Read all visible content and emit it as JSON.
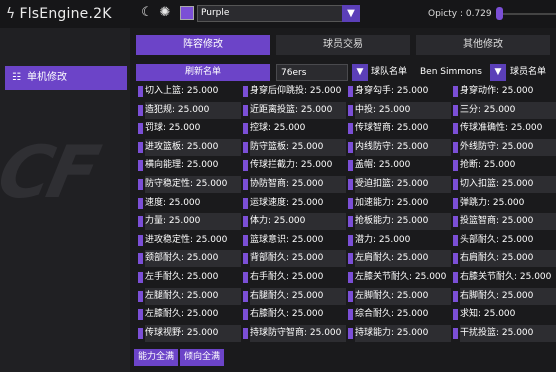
{
  "app": {
    "title": "FlsEngine.2K"
  },
  "topbar": {
    "theme_label": "Purple",
    "opacity_label": "Opicty : 0.729",
    "opacity_value": 0.729,
    "accent_color": "#7b4fd6"
  },
  "sidebar": {
    "items": [
      {
        "label": "单机修改",
        "icon": "grid-icon"
      }
    ]
  },
  "tabs": [
    {
      "label": "阵容修改",
      "active": true
    },
    {
      "label": "球员交易",
      "active": false
    },
    {
      "label": "其他修改",
      "active": false
    }
  ],
  "toolbar": {
    "refresh_label": "刷新名单",
    "team_value": "76ers",
    "roster_label": "球队名单",
    "player_value": "Ben Simmons",
    "attr_label": "球员名单"
  },
  "attributes": [
    "切入上篮: 25.000",
    "身穿后仰跳投: 25.000",
    "身穿勾手: 25.000",
    "身穿动作: 25.000",
    "造犯规: 25.000",
    "近距离投篮: 25.000",
    "中投: 25.000",
    "三分: 25.000",
    "罚球: 25.000",
    "控球: 25.000",
    "传球智商: 25.000",
    "传球准确性: 25.000",
    "进攻篮板: 25.000",
    "防守篮板: 25.000",
    "内线防守: 25.000",
    "外线防守: 25.000",
    "横向能理: 25.000",
    "传球拦截力: 25.000",
    "盖帽: 25.000",
    "抢断: 25.000",
    "防守稳定性: 25.000",
    "协防智商: 25.000",
    "受迫扣篮: 25.000",
    "切入扣篮: 25.000",
    "速度: 25.000",
    "运球速度: 25.000",
    "加速能力: 25.000",
    "弹跳力: 25.000",
    "力量: 25.000",
    "体力: 25.000",
    "抢板能力: 25.000",
    "投篮智商: 25.000",
    "进攻稳定性: 25.000",
    "篮球意识: 25.000",
    "潜力: 25.000",
    "头部耐久: 25.000",
    "颈部耐久: 25.000",
    "背部耐久: 25.000",
    "左肩耐久: 25.000",
    "右肩耐久: 25.000",
    "左手耐久: 25.000",
    "右手耐久: 25.000",
    "左膝关节耐久: 25.000",
    "右膝关节耐久: 25.000",
    "左腿耐久: 25.000",
    "右腿耐久: 25.000",
    "左脚耐久: 25.000",
    "右脚耐久: 25.000",
    "左膝耐久: 25.000",
    "右膝耐久: 25.000",
    "综合耐久: 25.000",
    "求知: 25.000",
    "传球视野: 25.000",
    "持球防守智商: 25.000",
    "持球能力: 25.000",
    "干扰投篮: 25.000"
  ],
  "footer": {
    "max_ability": "能力全满",
    "max_tendency": "倾向全满"
  }
}
